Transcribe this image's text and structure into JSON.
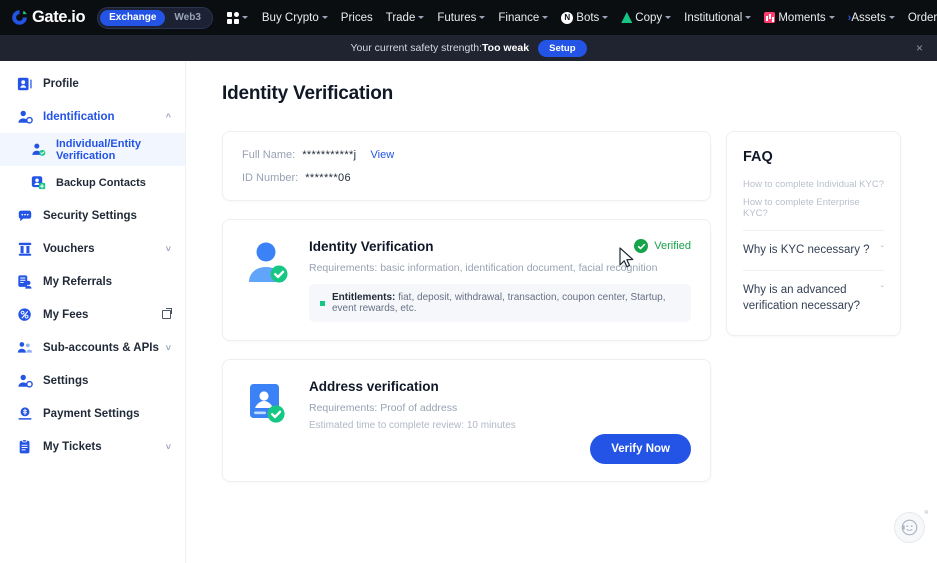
{
  "topnav": {
    "brand": "Gate.io",
    "segments": [
      {
        "label": "Exchange",
        "active": true
      },
      {
        "label": "Web3",
        "active": false
      }
    ],
    "items": [
      {
        "label": "Buy Crypto",
        "caret": true,
        "icon": null
      },
      {
        "label": "Prices",
        "caret": false,
        "icon": null
      },
      {
        "label": "Trade",
        "caret": true,
        "icon": null
      },
      {
        "label": "Futures",
        "caret": true,
        "icon": null
      },
      {
        "label": "Finance",
        "caret": true,
        "icon": null
      },
      {
        "label": "Bots",
        "caret": true,
        "icon": "bots-icon"
      },
      {
        "label": "Copy",
        "caret": true,
        "icon": "copy-trading-icon"
      },
      {
        "label": "Institutional",
        "caret": true,
        "icon": null
      },
      {
        "label": "Moments",
        "caret": true,
        "icon": "moments-icon"
      }
    ],
    "more_arrow": "›",
    "right_items": [
      {
        "label": "Assets",
        "caret": true
      },
      {
        "label": "Order",
        "caret": true
      }
    ],
    "right_icons": [
      "avatar",
      "download-icon",
      "search-icon",
      "menu-icon"
    ]
  },
  "notice": {
    "text": "Your current safety strength:",
    "strength": "Too weak",
    "setup_label": "Setup",
    "close": "×"
  },
  "sidebar": {
    "items": [
      {
        "label": "Profile",
        "icon": "profile-icon",
        "name": "profile",
        "blue": false,
        "sub": false,
        "chevron": null,
        "external": false,
        "active": false
      },
      {
        "label": "Identification",
        "icon": "identification-icon",
        "name": "identification",
        "blue": true,
        "sub": false,
        "chevron": "up",
        "external": false,
        "active": false
      },
      {
        "label": "Individual/Entity Verification",
        "icon": "individual-verification-icon",
        "name": "individual-entity-verification",
        "blue": true,
        "sub": true,
        "chevron": null,
        "external": false,
        "active": true
      },
      {
        "label": "Backup Contacts",
        "icon": "backup-contacts-icon",
        "name": "backup-contacts",
        "blue": false,
        "sub": true,
        "chevron": null,
        "external": false,
        "active": false
      },
      {
        "label": "Security Settings",
        "icon": "security-settings-icon",
        "name": "security-settings",
        "blue": false,
        "sub": false,
        "chevron": null,
        "external": false,
        "active": false
      },
      {
        "label": "Vouchers",
        "icon": "vouchers-icon",
        "name": "vouchers",
        "blue": false,
        "sub": false,
        "chevron": "down",
        "external": false,
        "active": false
      },
      {
        "label": "My Referrals",
        "icon": "referrals-icon",
        "name": "my-referrals",
        "blue": false,
        "sub": false,
        "chevron": null,
        "external": false,
        "active": false
      },
      {
        "label": "My Fees",
        "icon": "fees-icon",
        "name": "my-fees",
        "blue": false,
        "sub": false,
        "chevron": null,
        "external": true,
        "active": false
      },
      {
        "label": "Sub-accounts & APIs",
        "icon": "sub-accounts-icon",
        "name": "sub-accounts-apis",
        "blue": false,
        "sub": false,
        "chevron": "down",
        "external": false,
        "active": false
      },
      {
        "label": "Settings",
        "icon": "settings-icon",
        "name": "settings",
        "blue": false,
        "sub": false,
        "chevron": null,
        "external": false,
        "active": false
      },
      {
        "label": "Payment Settings",
        "icon": "payment-settings-icon",
        "name": "payment-settings",
        "blue": false,
        "sub": false,
        "chevron": null,
        "external": false,
        "active": false
      },
      {
        "label": "My Tickets",
        "icon": "tickets-icon",
        "name": "my-tickets",
        "blue": false,
        "sub": false,
        "chevron": "down",
        "external": false,
        "active": false
      }
    ]
  },
  "main": {
    "page_title": "Identity Verification",
    "info": {
      "full_name_label": "Full Name:",
      "full_name_value": "***********j",
      "view_label": "View",
      "id_number_label": "ID Number:",
      "id_number_value": "*******06"
    },
    "identity_card": {
      "title": "Identity Verification",
      "requirements": "Requirements: basic information, identification document, facial recognition",
      "entitlements_label": "Entitlements:",
      "entitlements_value": "fiat, deposit, withdrawal, transaction, coupon center, Startup, event rewards, etc.",
      "status": "Verified",
      "status_color": "#16a34a"
    },
    "address_card": {
      "title": "Address verification",
      "requirements": "Requirements: Proof of address",
      "estimate": "Estimated time to complete review: 10 minutes",
      "button": "Verify Now"
    }
  },
  "faq": {
    "title": "FAQ",
    "links": [
      "How to complete Individual KYC?",
      "How to complete Enterprise KYC?"
    ],
    "questions": [
      "Why is KYC necessary ?",
      "Why is an advanced verification necessary?"
    ],
    "chevron": "ˇ"
  },
  "support": {
    "icon": "customer-support-icon",
    "close": "×"
  },
  "colors": {
    "brand_blue": "#2354e6",
    "nav_dark": "#0b0e11",
    "notice_bg": "#1f2430",
    "success_green": "#16a34a",
    "accent_green": "#16c784"
  }
}
